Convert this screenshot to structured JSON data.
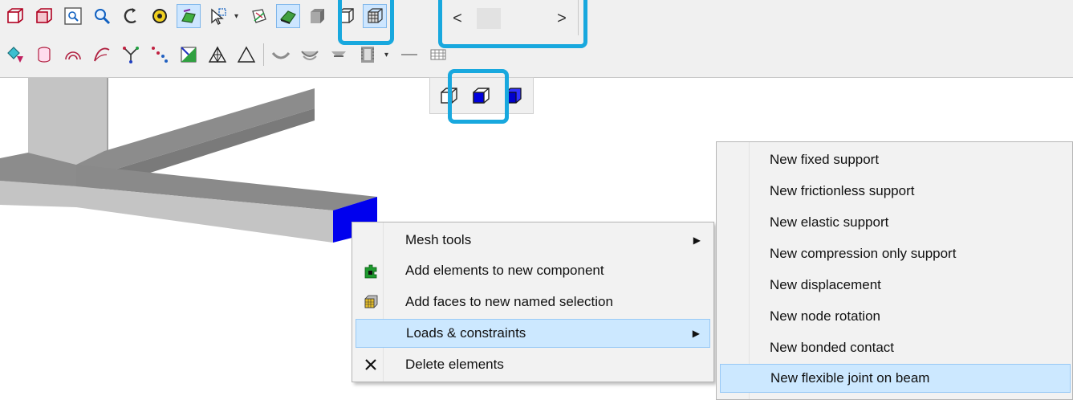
{
  "toolbar": {
    "row1": [
      {
        "icon": "box-view-icon"
      },
      {
        "icon": "box-open-view-icon"
      },
      {
        "icon": "zoom-window-icon"
      },
      {
        "icon": "zoom-icon"
      },
      {
        "icon": "rotate-view-icon"
      },
      {
        "icon": "pan-view-icon"
      },
      {
        "icon": "select-surfaces-icon",
        "selected": true
      },
      {
        "icon": "select-mode-icon",
        "dropdown": true
      },
      {
        "icon": "section-plane-icon"
      },
      {
        "icon": "surface-shaded-icon",
        "selected": true
      },
      {
        "icon": "shaded-box-icon"
      },
      {
        "icon": "wireframe-box-icon"
      },
      {
        "icon": "mesh-box-icon",
        "selected": true
      }
    ],
    "row2": [
      {
        "icon": "geometry-select-icon"
      },
      {
        "icon": "cylinder-icon"
      },
      {
        "icon": "fillet-icon"
      },
      {
        "icon": "curve-icon"
      },
      {
        "icon": "node-split-icon"
      },
      {
        "icon": "dots-icon"
      },
      {
        "icon": "mesh-element-icon"
      },
      {
        "icon": "triangle-mesh-icon"
      },
      {
        "icon": "triangle-outline-icon"
      },
      {
        "icon": "shell-bowl-icon"
      },
      {
        "icon": "shell-bowl-2-icon"
      },
      {
        "icon": "shell-bowl-3-icon"
      },
      {
        "icon": "film-icon"
      },
      {
        "icon": "line-icon"
      },
      {
        "icon": "grid-icon"
      }
    ],
    "scroller": {
      "left": "<",
      "right": ">"
    }
  },
  "view_popup": [
    {
      "icon": "wire-cube-icon"
    },
    {
      "icon": "blue-face-cube-icon",
      "selected": true
    },
    {
      "icon": "solid-blue-cube-icon"
    }
  ],
  "context_menu": {
    "items": [
      {
        "label": "Mesh tools",
        "icon": "",
        "submenu": true
      },
      {
        "label": "Add elements to new component",
        "icon": "puzzle-piece-icon",
        "submenu": false
      },
      {
        "label": "Add faces to new named selection",
        "icon": "face-selection-icon",
        "submenu": false
      },
      {
        "label": "Loads & constraints",
        "icon": "",
        "submenu": true,
        "active": true
      },
      {
        "label": "Delete elements",
        "icon": "delete-x-icon",
        "submenu": false
      }
    ],
    "submenu_arrow": "▶"
  },
  "submenu": {
    "items": [
      {
        "label": "New fixed support"
      },
      {
        "label": "New frictionless support"
      },
      {
        "label": "New elastic support"
      },
      {
        "label": "New compression only support"
      },
      {
        "label": "New displacement"
      },
      {
        "label": "New node rotation"
      },
      {
        "label": "New bonded contact"
      },
      {
        "label": "New flexible joint on beam",
        "active": true
      }
    ]
  },
  "colors": {
    "highlight": "#18a8de",
    "menu_active": "#cce8ff",
    "beam_top": "#8c8c8c",
    "beam_side": "#c4c4c4",
    "selected_face": "#0000ee"
  }
}
